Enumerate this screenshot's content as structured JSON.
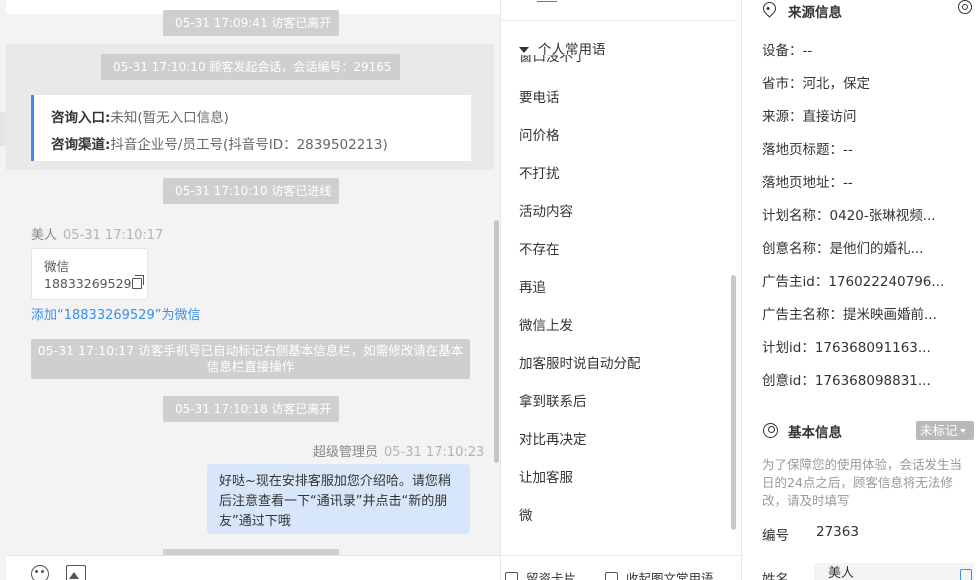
{
  "chat": {
    "sys_left_1": "05-31 17:09:41 访客已离开",
    "sys_session": "05-31 17:10:10 顾客发起会话，会话编号：29165",
    "consult": {
      "entry_label": "咨询入口:",
      "entry_value": "未知(暂无入口信息)",
      "channel_label": "咨询渠道:",
      "channel_value": "抖音企业号/员工号(抖音号ID：2839502213)"
    },
    "sys_joined": "05-31 17:10:10 访客已进线",
    "visitor_name": "美人",
    "visitor_time": "05-31 17:10:17",
    "wechat_card": {
      "title": "微信",
      "number": "18833269529"
    },
    "add_wechat_link": "添加“18833269529”为微信",
    "sys_phone_note": "05-31 17:10:17 访客手机号已自动标记右侧基本信息栏，如需修改请在基本信息栏直接操作",
    "sys_left_2": "05-31 17:10:18 访客已离开",
    "agent_name": "超级管理员",
    "agent_time": "05-31 17:10:23",
    "agent_message": "好哒~现在安排客服加您介绍哈。请您稍后注意查看一下“通讯录”并点击“新的朋友”通过下哦",
    "icons": [
      "emoji-icon",
      "image-icon"
    ]
  },
  "phrases": {
    "group_label": "个人常用语",
    "clipped_item": "窗口没不了",
    "items": [
      "要电话",
      "问价格",
      "不打扰",
      "活动内容",
      "不存在",
      "再追",
      "微信上发",
      "加客服时说自动分配",
      "拿到联系后",
      "对比再决定",
      "让加客服",
      "微"
    ],
    "bottom": {
      "card_label": "留资卡片",
      "collapse_label": "收起图文常用语"
    }
  },
  "info": {
    "source_title": "来源信息",
    "source_fields": [
      "设备：--",
      "省市：河北，保定",
      "来源：直接访问",
      "落地页标题：--",
      "落地页地址：--",
      "计划名称：0420-张琳视频...",
      "创意名称：是他们的婚礼...",
      "广告主id：176022240796...",
      "广告主名称：提米映画婚前...",
      "计划id：176368091163...",
      "创意id：176368098831..."
    ],
    "basic_title": "基本信息",
    "tag_label": "未标记",
    "note": "为了保障您的使用体验，会话发生当日的24点之后，顾客信息将无法修改，请及时填写",
    "id_label": "编号",
    "id_value": "27363",
    "name_label": "姓名",
    "name_value": "美人"
  }
}
